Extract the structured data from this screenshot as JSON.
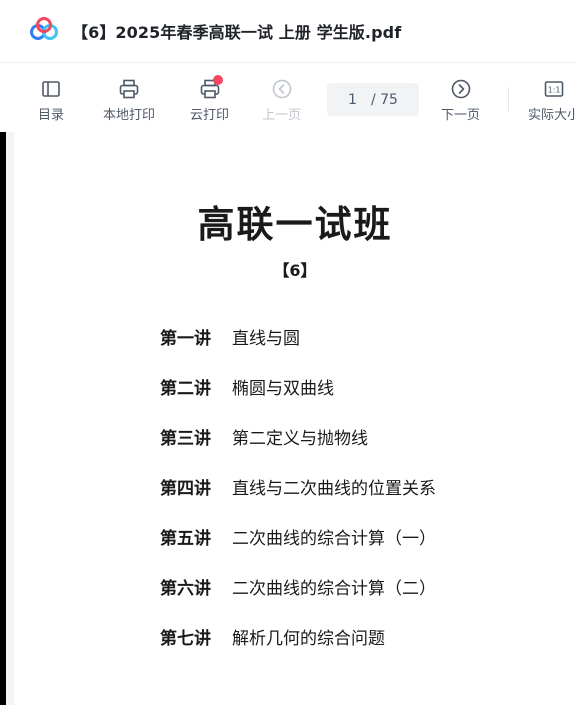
{
  "titlebar": {
    "title": "【6】2025年春季高联一试 上册 学生版.pdf"
  },
  "toolbar": {
    "items": [
      {
        "label": "目录",
        "icon": "toc-icon"
      },
      {
        "label": "本地打印",
        "icon": "printer-icon"
      },
      {
        "label": "云打印",
        "icon": "cloud-printer-icon"
      },
      {
        "label": "上一页",
        "icon": "chevron-left-circle-icon"
      },
      {
        "label": "下一页",
        "icon": "chevron-right-circle-icon"
      },
      {
        "label": "实际大小",
        "icon": "actual-size-icon",
        "icon_text": "1:1"
      }
    ],
    "page_current": "1",
    "page_total": "/ 75"
  },
  "document": {
    "title": "高联一试班",
    "subtitle": "【6】",
    "toc": [
      {
        "num": "第一讲",
        "text": "直线与圆"
      },
      {
        "num": "第二讲",
        "text": "椭圆与双曲线"
      },
      {
        "num": "第三讲",
        "text": "第二定义与抛物线"
      },
      {
        "num": "第四讲",
        "text": "直线与二次曲线的位置关系"
      },
      {
        "num": "第五讲",
        "text": "二次曲线的综合计算（一）"
      },
      {
        "num": "第六讲",
        "text": "二次曲线的综合计算（二）"
      },
      {
        "num": "第七讲",
        "text": "解析几何的综合问题"
      }
    ]
  },
  "colors": {
    "notification_dot": "#f5475f",
    "logo_blue": "#2f7cf6",
    "logo_cyan": "#3fc3f0"
  }
}
